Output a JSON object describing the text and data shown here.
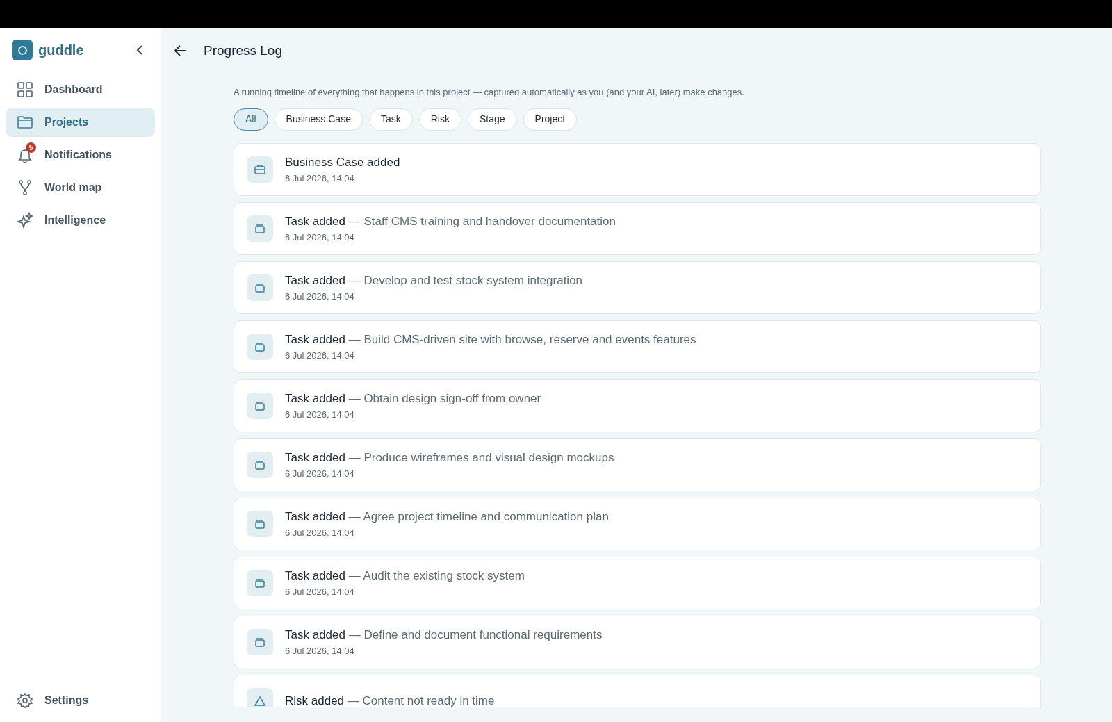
{
  "sidebar": {
    "brand": "guddle",
    "items": [
      {
        "label": "Dashboard",
        "kind": "grid",
        "selected": false
      },
      {
        "label": "Projects",
        "kind": "folder",
        "selected": true
      },
      {
        "label": "Notifications",
        "kind": "bell",
        "selected": false,
        "badge": "5"
      },
      {
        "label": "World map",
        "kind": "branch",
        "selected": false
      },
      {
        "label": "Intelligence",
        "kind": "sparkle",
        "selected": false
      }
    ],
    "footer_item": {
      "label": "Settings",
      "kind": "gear"
    }
  },
  "header": {
    "title": "Progress Log"
  },
  "description": "A running timeline of everything that happens in this project — captured automatically as you (and your AI, later) make changes.",
  "filters": [
    {
      "label": "All",
      "selected": true
    },
    {
      "label": "Business Case",
      "selected": false
    },
    {
      "label": "Task",
      "selected": false
    },
    {
      "label": "Risk",
      "selected": false
    },
    {
      "label": "Stage",
      "selected": false
    },
    {
      "label": "Project",
      "selected": false
    }
  ],
  "entries": [
    {
      "kind": "business_case",
      "title": "Business Case added",
      "time": "6 Jul 2026, 14:04"
    },
    {
      "kind": "task",
      "title": "Task added",
      "detail": "— Staff CMS training and handover documentation",
      "time": "6 Jul 2026, 14:04"
    },
    {
      "kind": "task",
      "title": "Task added",
      "detail": "— Develop and test stock system integration",
      "time": "6 Jul 2026, 14:04"
    },
    {
      "kind": "task",
      "title": "Task added",
      "detail": "— Build CMS-driven site with browse, reserve and events features",
      "time": "6 Jul 2026, 14:04"
    },
    {
      "kind": "task",
      "title": "Task added",
      "detail": "— Obtain design sign-off from owner",
      "time": "6 Jul 2026, 14:04"
    },
    {
      "kind": "task",
      "title": "Task added",
      "detail": "— Produce wireframes and visual design mockups",
      "time": "6 Jul 2026, 14:04"
    },
    {
      "kind": "task",
      "title": "Task added",
      "detail": "— Agree project timeline and communication plan",
      "time": "6 Jul 2026, 14:04"
    },
    {
      "kind": "task",
      "title": "Task added",
      "detail": "— Audit the existing stock system",
      "time": "6 Jul 2026, 14:04"
    },
    {
      "kind": "task",
      "title": "Task added",
      "detail": "— Define and document functional requirements",
      "time": "6 Jul 2026, 14:04"
    },
    {
      "kind": "risk",
      "title": "Risk added",
      "detail": "— Content not ready in time"
    }
  ]
}
